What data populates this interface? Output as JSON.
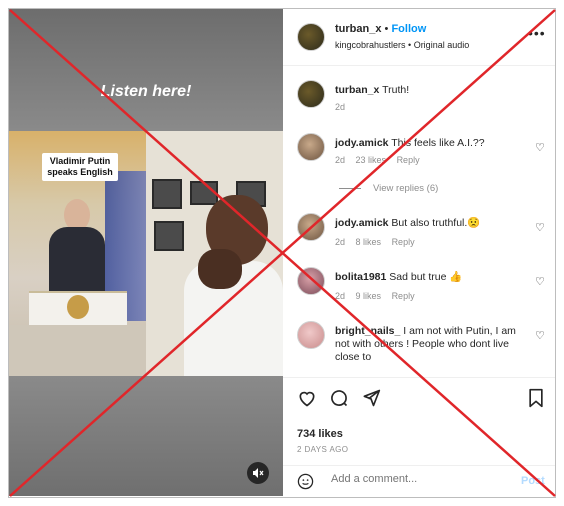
{
  "media": {
    "overlay_text": "Listen here!",
    "caption": "Vladimir Putin speaks English",
    "mute_icon": "speaker-muted-icon"
  },
  "header": {
    "username": "turban_x",
    "separator": "•",
    "follow_label": "Follow",
    "audio_text": "kingcobrahustlers • Original audio",
    "more_icon": "more-horizontal-icon"
  },
  "comments": [
    {
      "user": "turban_x",
      "text": "Truth!",
      "time": "2d"
    },
    {
      "user": "jody.amick",
      "text": "This feels like A.I.??",
      "time": "2d",
      "likes": "23 likes",
      "reply": "Reply",
      "view_replies": "View replies (6)"
    },
    {
      "user": "jody.amick",
      "text": "But also truthful.😟",
      "time": "2d",
      "likes": "8 likes",
      "reply": "Reply"
    },
    {
      "user": "bolita1981",
      "text": "Sad but true 👍",
      "time": "2d",
      "likes": "9 likes",
      "reply": "Reply"
    },
    {
      "user": "bright_nails_",
      "text": "I am not with Putin, I am not with others ! People who dont live close to"
    }
  ],
  "actions": {
    "likes": "734 likes",
    "date": "2 DAYS AGO",
    "comment_placeholder": "Add a comment...",
    "post_label": "Post"
  },
  "colors": {
    "accent": "#0095f6",
    "cross": "#e0262a"
  }
}
